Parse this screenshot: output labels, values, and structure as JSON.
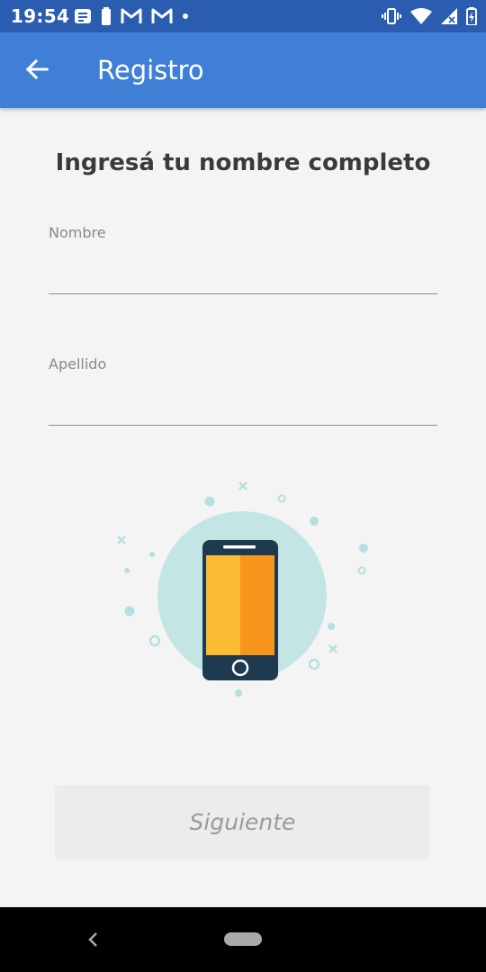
{
  "status_bar": {
    "time": "19:54",
    "left_icons": [
      "message-icon",
      "battery-saver-icon",
      "gmail-icon",
      "gmail-icon",
      "dot-icon"
    ],
    "right_icons": [
      "vibrate-icon",
      "wifi-icon",
      "signal-icon",
      "battery-icon"
    ]
  },
  "app_bar": {
    "title": "Registro",
    "back_icon": "arrow-left-icon"
  },
  "form": {
    "heading": "Ingresá tu nombre completo",
    "first_name_label": "Nombre",
    "first_name_value": "",
    "last_name_label": "Apellido",
    "last_name_value": ""
  },
  "illustration": {
    "icon": "smartphone-illustration",
    "colors": {
      "circle": "#c3e6e5",
      "phone_body": "#1d3a4f",
      "screen_left": "#fbbb33",
      "screen_right": "#f7951c",
      "decoration": "#b6dfe0"
    }
  },
  "actions": {
    "next_label": "Siguiente"
  },
  "nav_bar": {
    "back_icon": "nav-back-icon",
    "home_icon": "home-pill-icon"
  },
  "colors": {
    "status_bar": "#2a5db0",
    "app_bar": "#3f7fd6",
    "background": "#f4f4f4"
  }
}
